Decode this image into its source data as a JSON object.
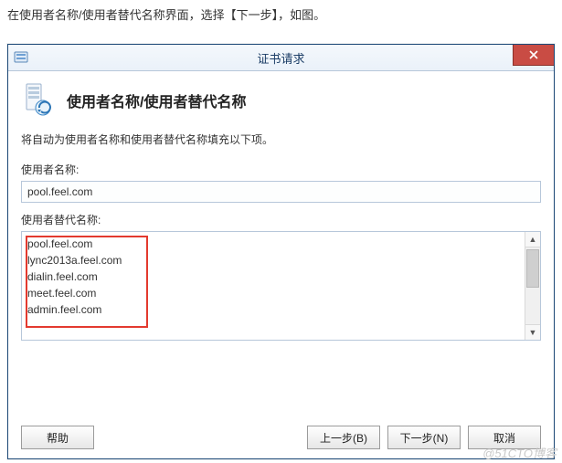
{
  "caption": "在使用者名称/使用者替代名称界面，选择【下一步】，如图。",
  "window": {
    "title": "证书请求",
    "heading": "使用者名称/使用者替代名称",
    "description": "将自动为使用者名称和使用者替代名称填充以下项。",
    "subject_label": "使用者名称:",
    "subject_value": "pool.feel.com",
    "san_label": "使用者替代名称:",
    "san_list": [
      "pool.feel.com",
      "lync2013a.feel.com",
      "dialin.feel.com",
      "meet.feel.com",
      "admin.feel.com"
    ],
    "buttons": {
      "help": "帮助",
      "back": "上一步(B)",
      "next": "下一步(N)",
      "cancel": "取消"
    }
  },
  "watermark": "@51CTO博客"
}
